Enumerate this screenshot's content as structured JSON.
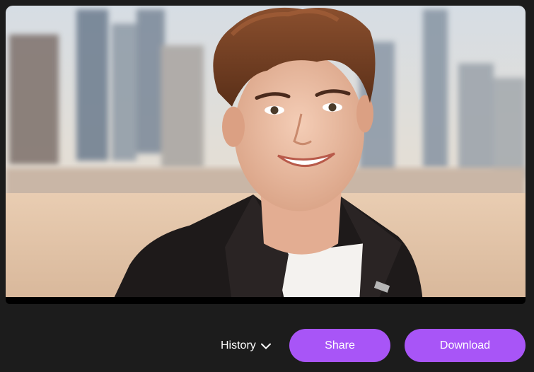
{
  "preview": {
    "image_alt": "Generated portrait photo: smiling young person with styled brown hair, black blazer and white t-shirt in front of a blurred city skyline"
  },
  "actions": {
    "history_label": "History",
    "history_icon": "chevron-down-icon",
    "share_label": "Share",
    "download_label": "Download"
  },
  "colors": {
    "background": "#1c1c1c",
    "accent": "#a855f7",
    "text": "#ffffff"
  }
}
